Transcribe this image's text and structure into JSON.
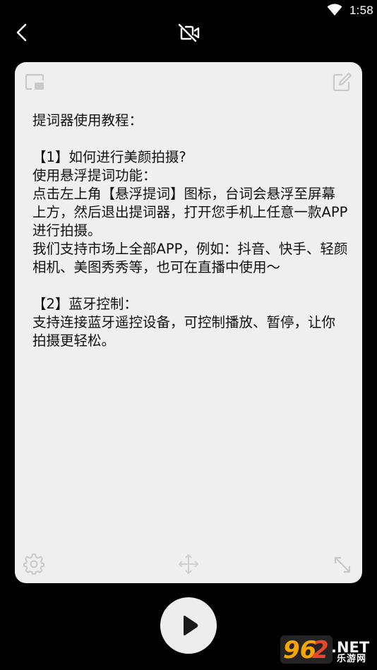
{
  "status_bar": {
    "time": "1:58",
    "wifi_icon": "wifi-icon",
    "battery_icon": "battery-icon"
  },
  "toolbar": {
    "back_icon": "chevron-left-icon",
    "camera_icon": "camera-off-icon"
  },
  "card": {
    "background": "#efefef",
    "top_left_icon": "floating-window-icon",
    "top_right_icon": "edit-icon",
    "content": "提词器使用教程：\n\n【1】如何进行美颜拍摄?\n使用悬浮提词功能：\n点击左上角【悬浮提词】图标，台词会悬浮至屏幕上方，然后退出提词器，打开您手机上任意一款APP进行拍摄。\n我们支持市场上全部APP，例如：抖音、快手、轻颜相机、美图秀秀等，也可在直播中使用～\n\n【2】蓝牙控制：\n支持连接蓝牙遥控设备，可控制播放、暂停，让你拍摄更轻松。",
    "bottom_left_icon": "gear-icon",
    "bottom_center_icon": "move-icon",
    "bottom_right_icon": "resize-icon"
  },
  "player": {
    "play_icon": "play-icon",
    "button_color": "#ededed"
  },
  "watermark": {
    "logo": "962.NET",
    "text": "乐游网",
    "colors": {
      "nine": "#f7a600",
      "six": "#f7a600",
      "two": "#e8472b",
      "net": "#f2f2f2"
    }
  }
}
